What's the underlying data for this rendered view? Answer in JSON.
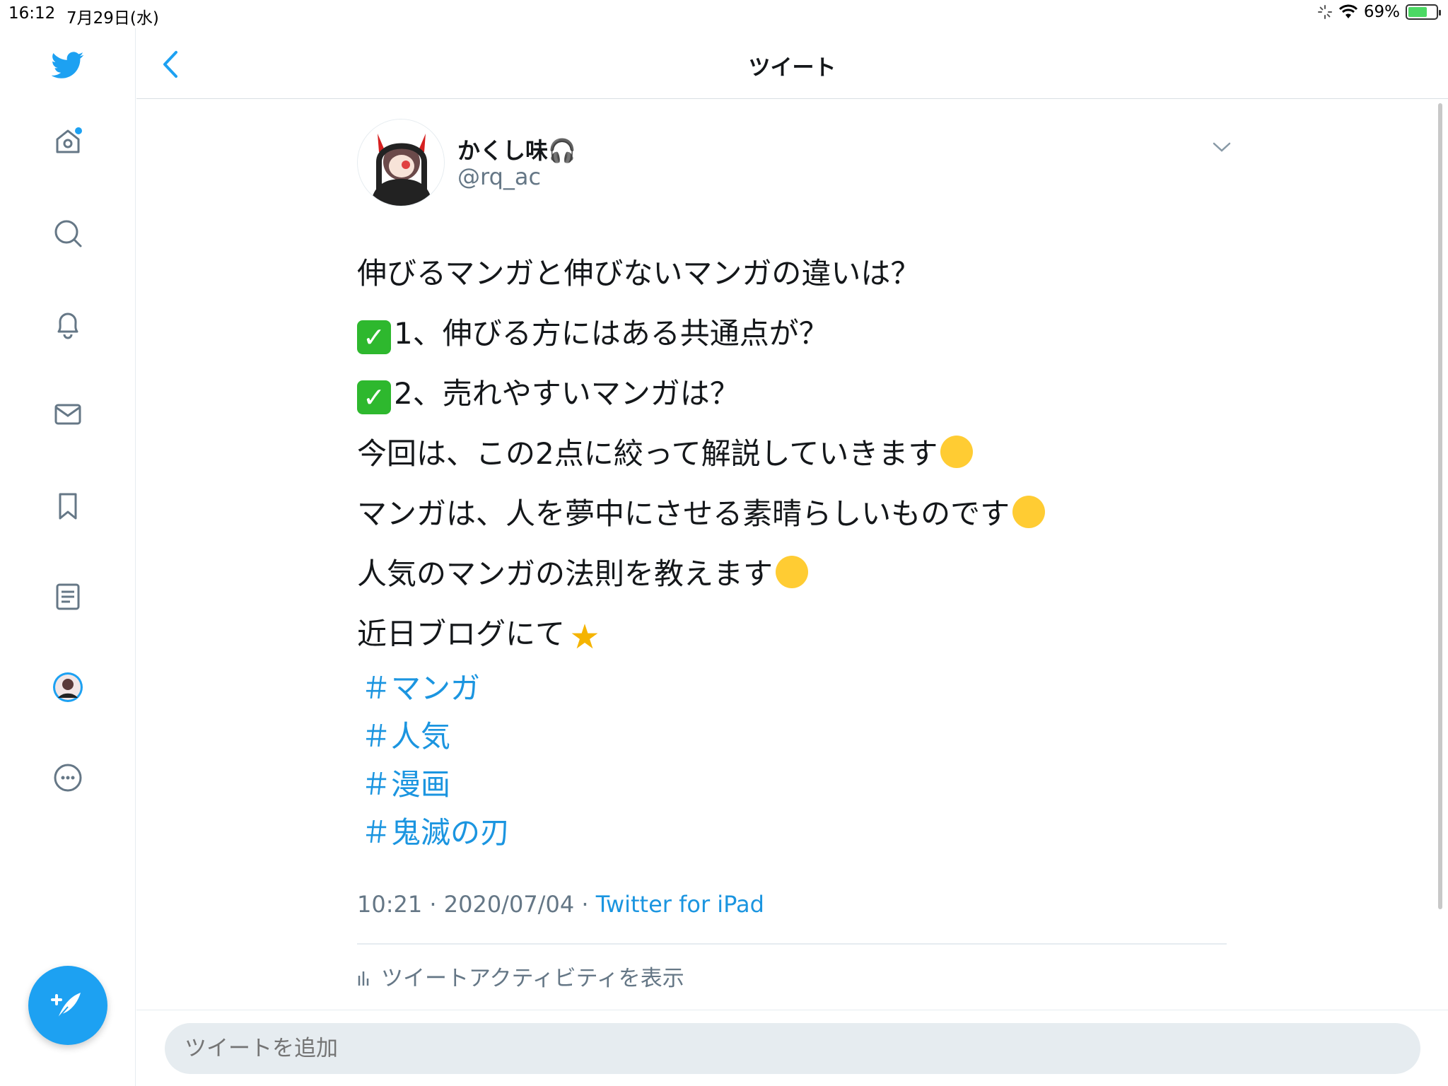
{
  "status_bar": {
    "time": "16:12",
    "date": "7月29日(水)",
    "battery": "69%",
    "battery_level": 0.69
  },
  "sidebar": {
    "items": [
      {
        "icon": "twitter-bird-icon"
      },
      {
        "icon": "home-icon",
        "has_notification_dot": true
      },
      {
        "icon": "search-icon"
      },
      {
        "icon": "bell-icon"
      },
      {
        "icon": "mail-icon"
      },
      {
        "icon": "bookmark-icon"
      },
      {
        "icon": "lists-icon"
      },
      {
        "icon": "profile-avatar-icon"
      },
      {
        "icon": "more-icon"
      }
    ],
    "compose_icon": "compose-feather-icon"
  },
  "header": {
    "title": "ツイート",
    "back_icon": "chevron-left-icon"
  },
  "tweet": {
    "author_name": "かくし味",
    "author_handle": "@rq_ac",
    "lines": [
      {
        "text": "伸びるマンガと伸びないマンガの違いは？"
      },
      {
        "prefix": "✅",
        "text": "1、伸びる方にはある共通点が？"
      },
      {
        "prefix": "✅",
        "text": "2、売れやすいマンガは？"
      },
      {
        "text": "今回は、この2点に絞って解説していきます",
        "suffix": "🤭"
      },
      {
        "text": "マンガは、人を夢中にさせる素晴らしいものです",
        "suffix": "😌"
      },
      {
        "text": "人気のマンガの法則を教えます",
        "suffix": "😌"
      },
      {
        "text": "近日ブログにて",
        "suffix": "🌟"
      }
    ],
    "hashtags": [
      "＃マンガ",
      "＃人気",
      "＃漫画",
      "＃鬼滅の刃"
    ],
    "timestamp": "10:21 · 2020/07/04 · ",
    "source": "Twitter for iPad",
    "activity_label": "ツイートアクティビティを表示"
  },
  "reply": {
    "placeholder": "ツイートを追加"
  },
  "colors": {
    "accent": "#1da1f2",
    "link": "#1b95e0",
    "secondary_text": "#657786",
    "reply_bg": "#e6ecf0"
  }
}
